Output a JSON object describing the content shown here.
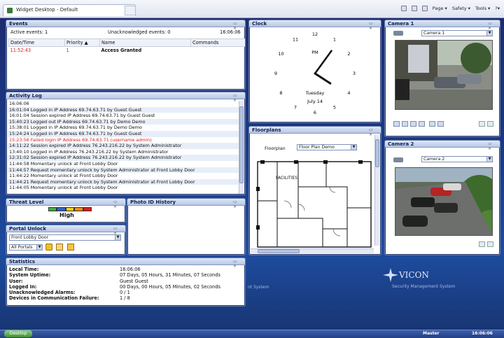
{
  "browser": {
    "tab_title": "Widget Desktop - Default",
    "menu": [
      "Page ▾",
      "Safety ▾",
      "Tools ▾",
      "?▾"
    ]
  },
  "events": {
    "title": "Events",
    "active_label": "Active events: 1",
    "unack_label": "Unacknowledged events: 0",
    "time": "16:06:06",
    "columns": [
      "Date/Time",
      "Priority ▲",
      "Name",
      "Commands"
    ],
    "rows": [
      {
        "time": "11:52:43",
        "priority": "1",
        "name": "Access Granted",
        "commands": ""
      }
    ]
  },
  "activity": {
    "title": "Activity Log",
    "entries": [
      {
        "text": "16:06:06",
        "alert": false
      },
      {
        "text": "16:01:04 Logged in IP Address 69.74.63.71 by Guest Guest",
        "alert": false
      },
      {
        "text": "16:01:04 Session expired IP Address 69.74.63.71 by Guest Guest",
        "alert": false
      },
      {
        "text": "15:40:23 Logged out IP Address 69.74.63.71 by Demo Demo",
        "alert": false
      },
      {
        "text": "15:38:01 Logged in IP Address 69.74.63.71 by Demo Demo",
        "alert": false
      },
      {
        "text": "15:24:24 Logged in IP Address 69.74.63.71 by Guest Guest",
        "alert": false
      },
      {
        "text": "15:23:56 Failed login IP Address 69.74.63.71 (username admin)",
        "alert": true
      },
      {
        "text": "14:11:22 Session expired IP Address 76.243.216.22 by System Administrator",
        "alert": false
      },
      {
        "text": "13:40:10 Logged in IP Address 76.243.216.22 by System Administrator",
        "alert": false
      },
      {
        "text": "12:31:02 Session expired IP Address 76.243.216.22 by System Administrator",
        "alert": false
      },
      {
        "text": "11:44:58 Momentary unlock at Front Lobby Door",
        "alert": false
      },
      {
        "text": "11:44:57 Request momentary unlock by System Administrator at Front Lobby Door",
        "alert": false
      },
      {
        "text": "11:44:22 Momentary unlock at Front Lobby Door",
        "alert": false
      },
      {
        "text": "11:44:21 Request momentary unlock by System Administrator at Front Lobby Door",
        "alert": false
      },
      {
        "text": "11:44:05 Momentary unlock at Front Lobby Door",
        "alert": false
      }
    ]
  },
  "threat": {
    "title": "Threat Level",
    "level": "High",
    "colors": [
      "#3cb043",
      "#2f63c8",
      "#f0d21a",
      "#f08a1a",
      "#d62020"
    ]
  },
  "photo": {
    "title": "Photo ID History"
  },
  "portal": {
    "title": "Portal Unlock",
    "door": "Front Lobby Door",
    "filter": "All Portals"
  },
  "stats": {
    "title": "Statistics",
    "items": [
      {
        "label": "Local Time:",
        "value": "16:06:06"
      },
      {
        "label": "System Uptime:",
        "value": "07 Days, 05 Hours, 31 Minutes, 07 Seconds"
      },
      {
        "label": "User:",
        "value": "Guest Guest"
      },
      {
        "label": "Logged In:",
        "value": "00 Days, 00 Hours, 05 Minutes, 02 Seconds"
      },
      {
        "label": "Unacknowledged Alarms:",
        "value": "0 / 1"
      },
      {
        "label": "Devices in Communication Failure:",
        "value": "1 / 8"
      }
    ]
  },
  "clock": {
    "title": "Clock",
    "ampm": "PM",
    "day": "Tuesday",
    "date": "July 14",
    "hour": 4,
    "minute": 6,
    "numbers": [
      "12",
      "1",
      "2",
      "3",
      "4",
      "5",
      "6",
      "7",
      "8",
      "9",
      "10",
      "11"
    ]
  },
  "floorplans": {
    "title": "Floorplans",
    "label": "Floorplan",
    "selected": "Floor Plan Demo",
    "room_label": "FACILITIES"
  },
  "camera1": {
    "title": "Camera 1",
    "selected": "Camera 1"
  },
  "camera2": {
    "title": "Camera 2",
    "selected": "Camera 2"
  },
  "branding": {
    "logo": "VICON",
    "tagline": "Security Management System",
    "left_fragment": "nt System"
  },
  "taskbar": {
    "start": "Desktop",
    "user": "Master",
    "time": "16:06:06"
  }
}
